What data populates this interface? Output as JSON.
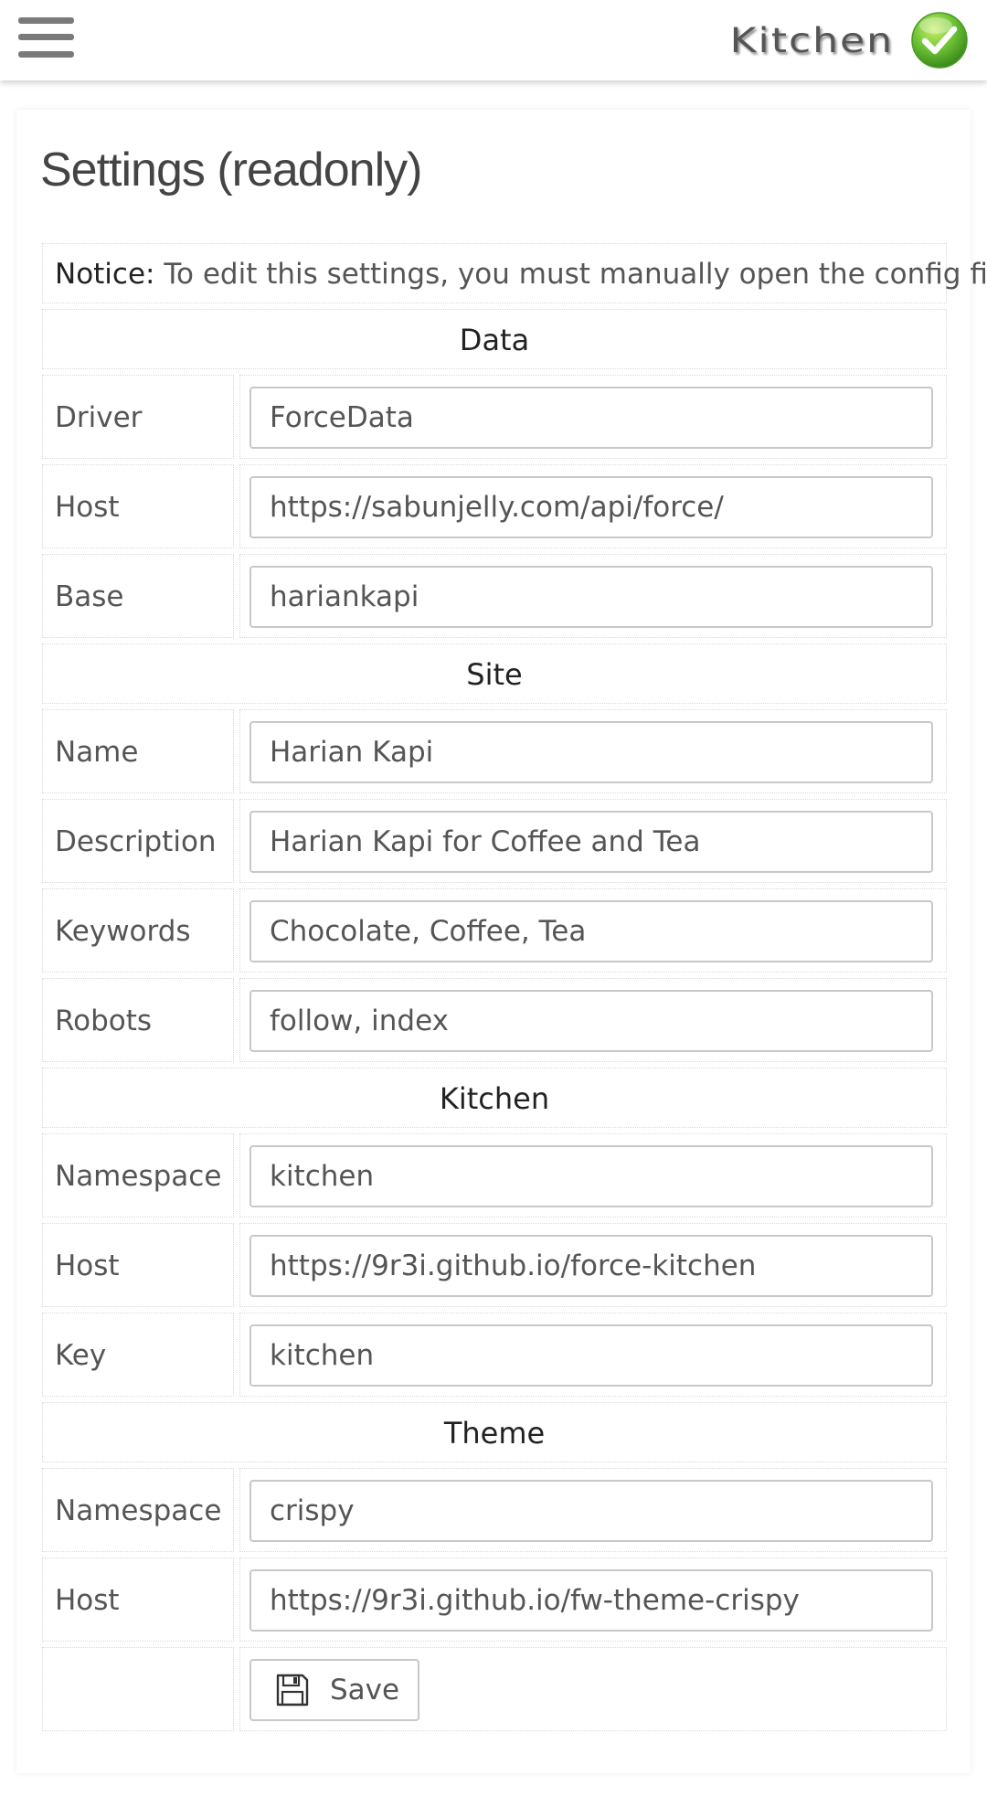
{
  "header": {
    "brand": "Kitchen"
  },
  "page": {
    "title": "Settings (readonly)"
  },
  "notice": {
    "label": "Notice:",
    "text": " To edit this settings, you must manually open the config file."
  },
  "sections": {
    "data": {
      "title": "Data",
      "fields": [
        {
          "label": "Driver",
          "value": "ForceData"
        },
        {
          "label": "Host",
          "value": "https://sabunjelly.com/api/force/"
        },
        {
          "label": "Base",
          "value": "hariankapi"
        }
      ]
    },
    "site": {
      "title": "Site",
      "fields": [
        {
          "label": "Name",
          "value": "Harian Kapi"
        },
        {
          "label": "Description",
          "value": "Harian Kapi for Coffee and Tea"
        },
        {
          "label": "Keywords",
          "value": "Chocolate, Coffee, Tea"
        },
        {
          "label": "Robots",
          "value": "follow, index"
        }
      ]
    },
    "kitchen": {
      "title": "Kitchen",
      "fields": [
        {
          "label": "Namespace",
          "value": "kitchen"
        },
        {
          "label": "Host",
          "value": "https://9r3i.github.io/force-kitchen"
        },
        {
          "label": "Key",
          "value": "kitchen"
        }
      ]
    },
    "theme": {
      "title": "Theme",
      "fields": [
        {
          "label": "Namespace",
          "value": "crispy"
        },
        {
          "label": "Host",
          "value": "https://9r3i.github.io/fw-theme-crispy"
        }
      ]
    }
  },
  "actions": {
    "save_label": "Save"
  },
  "colors": {
    "check_green": "#5fb83b",
    "menu_gray": "#7a7a7a",
    "input_border": "#c8c8c8"
  },
  "icons": {
    "menu": "hamburger-menu-icon",
    "brand_check": "check-icon",
    "save": "floppy-disk-icon"
  }
}
